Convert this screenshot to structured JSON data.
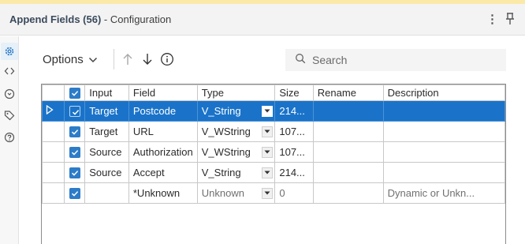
{
  "window": {
    "title_bold": "Append Fields (56)",
    "title_rest": " - Configuration",
    "menu_icon": "kebab-menu-icon",
    "pin_icon": "pin-icon"
  },
  "sidebar": {
    "items": [
      {
        "icon": "gear-icon",
        "active": true
      },
      {
        "icon": "code-icon"
      },
      {
        "icon": "target-icon"
      },
      {
        "icon": "tag-icon"
      },
      {
        "icon": "help-icon"
      }
    ]
  },
  "toolbar": {
    "options_label": "Options",
    "search_placeholder": "Search"
  },
  "grid": {
    "columns": [
      "Input",
      "Field",
      "Type",
      "Size",
      "Rename",
      "Description"
    ],
    "rows": [
      {
        "selected": true,
        "checked": true,
        "input": "Target",
        "field": "Postcode",
        "type": "V_String",
        "size": "214...",
        "rename": "",
        "description": ""
      },
      {
        "selected": false,
        "checked": true,
        "input": "Target",
        "field": "URL",
        "type": "V_WString",
        "size": "107...",
        "rename": "",
        "description": ""
      },
      {
        "selected": false,
        "checked": true,
        "input": "Source",
        "field": "Authorization",
        "type": "V_WString",
        "size": "107...",
        "rename": "",
        "description": ""
      },
      {
        "selected": false,
        "checked": true,
        "input": "Source",
        "field": "Accept",
        "type": "V_String",
        "size": "214...",
        "rename": "",
        "description": ""
      },
      {
        "selected": false,
        "checked": true,
        "input": "",
        "field": "*Unknown",
        "type": "Unknown",
        "size": "0",
        "rename": "",
        "description": "Dynamic or Unkn..."
      }
    ]
  },
  "colors": {
    "selection": "#1a73c9",
    "checkbox": "#2d7cc8",
    "accent_bar": "#fbe9a8"
  }
}
